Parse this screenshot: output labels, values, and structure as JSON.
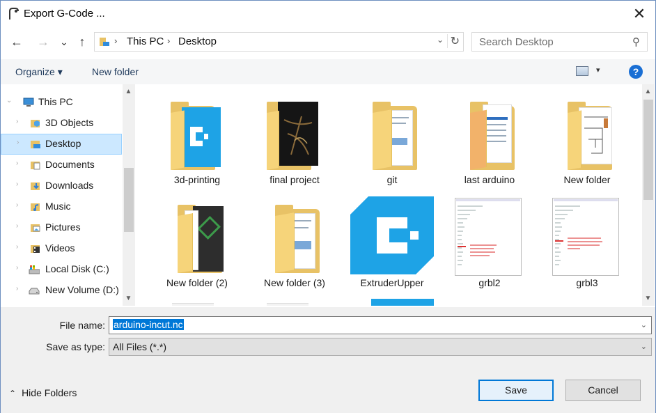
{
  "window": {
    "title": "Export G-Code ...",
    "close_glyph": "✕",
    "app_icon": "arduino-app-icon"
  },
  "nav": {
    "back_glyph": "←",
    "forward_glyph": "→",
    "recent_glyph": "⌄",
    "up_glyph": "↑",
    "breadcrumb": [
      "This PC",
      "Desktop"
    ],
    "crumb_sep": "›",
    "address_dropdown_glyph": "⌄",
    "refresh_glyph": "↻",
    "search_placeholder": "Search Desktop",
    "search_glyph": "⚲"
  },
  "toolbar": {
    "organize": "Organize ▾",
    "new_folder": "New folder",
    "view_dropdown_glyph": "▾",
    "help": "?"
  },
  "sidebar": {
    "items": [
      {
        "label": "This PC",
        "icon": "computer-icon"
      },
      {
        "label": "3D Objects",
        "icon": "3d-objects-icon"
      },
      {
        "label": "Desktop",
        "icon": "desktop-icon",
        "selected": true
      },
      {
        "label": "Documents",
        "icon": "documents-icon"
      },
      {
        "label": "Downloads",
        "icon": "downloads-icon"
      },
      {
        "label": "Music",
        "icon": "music-icon"
      },
      {
        "label": "Pictures",
        "icon": "pictures-icon"
      },
      {
        "label": "Videos",
        "icon": "videos-icon"
      },
      {
        "label": "Local Disk (C:)",
        "icon": "local-disk-icon"
      },
      {
        "label": "New Volume (D:)",
        "icon": "drive-icon"
      }
    ]
  },
  "files": {
    "items": [
      {
        "name": "3d-printing",
        "kind": "folder"
      },
      {
        "name": "final project",
        "kind": "folder"
      },
      {
        "name": "git",
        "kind": "folder"
      },
      {
        "name": "last arduino",
        "kind": "folder"
      },
      {
        "name": "New folder",
        "kind": "folder"
      },
      {
        "name": "New folder (2)",
        "kind": "folder"
      },
      {
        "name": "New folder (3)",
        "kind": "folder"
      },
      {
        "name": "ExtruderUpper",
        "kind": "app"
      },
      {
        "name": "grbl2",
        "kind": "screenshot"
      },
      {
        "name": "grbl3",
        "kind": "screenshot"
      }
    ]
  },
  "form": {
    "file_name_label": "File name:",
    "file_name_value": "arduino-incut.nc",
    "save_type_label": "Save as type:",
    "save_type_value": "All Files (*.*)",
    "dropdown_glyph": "⌄"
  },
  "footer": {
    "hide_folders": "Hide Folders",
    "hide_glyph": "⌃",
    "save": "Save",
    "cancel": "Cancel"
  },
  "colors": {
    "accent": "#0078d7",
    "folder": "#e8c266",
    "cura": "#1ea3e6",
    "selection": "#cce8ff"
  }
}
